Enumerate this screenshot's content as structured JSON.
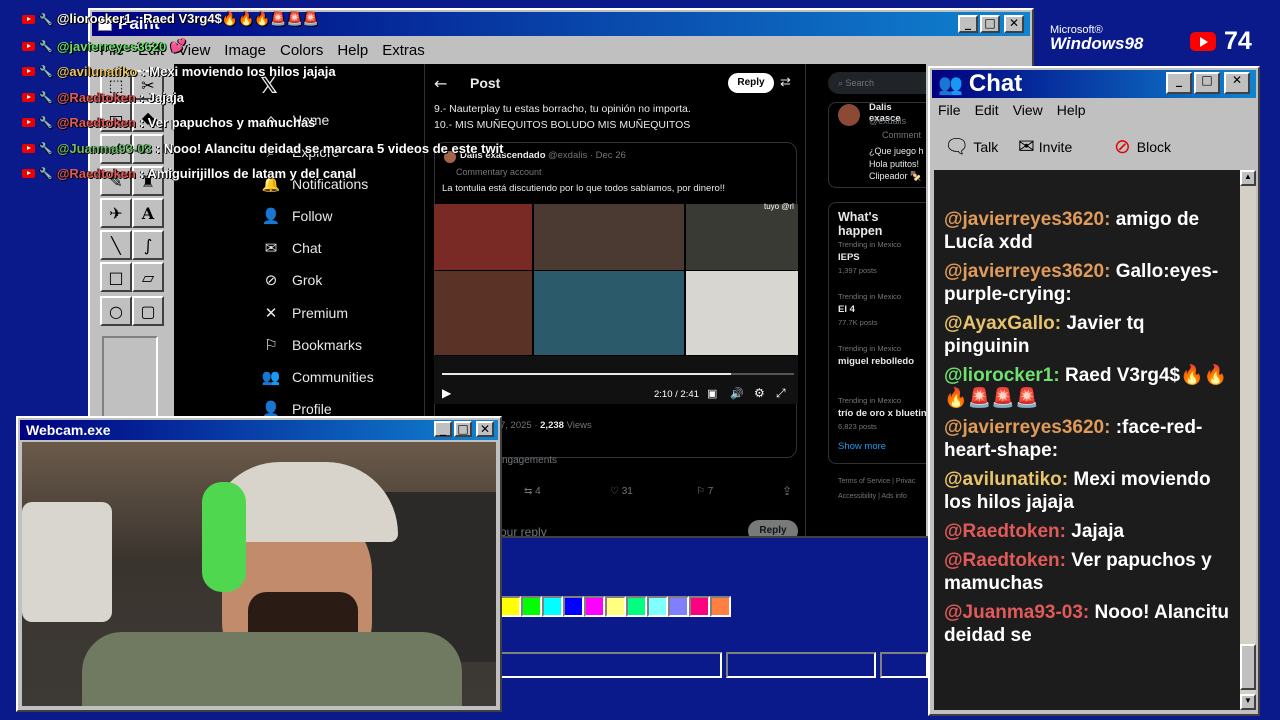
{
  "overlay": {
    "top_line": "@liorocker1 : Raed V3rg4$🔥🔥🔥🚨🚨🚨",
    "lines": [
      {
        "user": "@javierreyes3620",
        "text": "💕",
        "color": "#6fe06f"
      },
      {
        "user": "@avilunatiko",
        "text": ": Mexi moviendo los hilos jajaja",
        "color": "#e8c46a"
      },
      {
        "user": "@Raedtoken",
        "text": ": Jajaja",
        "color": "#e05a5a"
      },
      {
        "user": "@Raedtoken",
        "text": ": Ver papuchos y mamuchas",
        "color": "#e05a5a"
      },
      {
        "user": "@Juanma93-03",
        "text": ": Nooo! Alancitu deidad se marcara 5 videos de este twit",
        "color": "#6fbf6f"
      },
      {
        "user": "@Raedtoken",
        "text": ": Amiguirijillos de latam y del canal",
        "color": "#e05a5a"
      }
    ],
    "windows98_logo_small": "Microsoft®",
    "windows98_logo": "Windows98",
    "viewer_count": "74"
  },
  "paint": {
    "title": "Paint",
    "menu": [
      "File",
      "Edit",
      "View",
      "Image",
      "Colors",
      "Help",
      "Extras"
    ],
    "palette": [
      "#ffff00",
      "#00ff00",
      "#00ffff",
      "#0000ff",
      "#ff00ff",
      "#ffff80",
      "#00ff80",
      "#80ffff",
      "#8080ff",
      "#ff0080",
      "#ff8040"
    ]
  },
  "x": {
    "nav": [
      "Home",
      "Explore",
      "Notifications",
      "Follow",
      "Chat",
      "Grok",
      "Premium",
      "Bookmarks",
      "Communities",
      "Profile"
    ],
    "post_header": "Post",
    "reply_button": "Reply",
    "post_line1": "9.- Nauterplay tu estas borracho, tu opinión no importa.",
    "post_line2": "10.- MIS MUÑEQUITOS BOLUDO MIS MUÑEQUITOS",
    "quote_name": "Dalis exascendado",
    "quote_handle": "@exdalis · Dec 26",
    "quote_badge": "Commentary account",
    "quote_text": "La tontulia está discutiendo por lo que todos sabíamos, por dinero!!",
    "video_time": "2:10 / 2:41",
    "video_progress": 0.82,
    "video_label": "tuyo @rl",
    "date_views": "7, 2025 · ",
    "views_count": "2,238",
    "views_label": "Views",
    "engagements": "ngagements",
    "retweets": "4",
    "likes": "31",
    "bookmarks": "7",
    "reply_placeholder": "our reply",
    "reply_button2": "Reply",
    "search_placeholder": "Search",
    "sidebar_user": "Dalis exasce",
    "sidebar_handle": "@exdalis",
    "sidebar_badge": "Comment",
    "sidebar_text1": "¿Que juego h",
    "sidebar_text2": "Hola putitos!",
    "sidebar_text3": "Clipeador 🍢",
    "whats_happening": "What's happen",
    "trends": [
      {
        "meta": "Trending in Mexico",
        "name": "IEPS",
        "posts": "1,397 posts"
      },
      {
        "meta": "Trending in Mexico",
        "name": "El 4",
        "posts": "77.7K posts"
      },
      {
        "meta": "Trending in Mexico",
        "name": "miguel rebolledo",
        "posts": ""
      },
      {
        "meta": "Trending in Mexico",
        "name": "trío de oro x bluetin",
        "posts": "6,823 posts"
      }
    ],
    "show_more": "Show more",
    "footer1": "Terms of Service  |  Privac",
    "footer2": "Accessibility  |  Ads info"
  },
  "chat": {
    "title": "Chat",
    "menu": [
      "File",
      "Edit",
      "View",
      "Help"
    ],
    "toolbar": [
      "Talk",
      "Invite",
      "Block"
    ],
    "messages": [
      {
        "user": "@javierreyes3620:",
        "text": " amigo de Lucía xdd",
        "color": "#e09a5a"
      },
      {
        "user": "@javierreyes3620:",
        "text": " Gallo:eyes-purple-crying:",
        "color": "#e09a5a"
      },
      {
        "user": "@AyaxGallo:",
        "text": " Javier tq pinguinin",
        "color": "#e8c46a"
      },
      {
        "user": "@liorocker1:",
        "text": " Raed V3rg4$🔥🔥🔥🚨🚨🚨",
        "color": "#6fe06f"
      },
      {
        "user": "@javierreyes3620:",
        "text": " :face-red-heart-shape:",
        "color": "#e09a5a"
      },
      {
        "user": "@avilunatiko:",
        "text": " Mexi moviendo los hilos jajaja",
        "color": "#e8c46a"
      },
      {
        "user": "@Raedtoken:",
        "text": " Jajaja",
        "color": "#e05a5a"
      },
      {
        "user": "@Raedtoken:",
        "text": " Ver papuchos y mamuchas",
        "color": "#e05a5a"
      },
      {
        "user": "@Juanma93-03:",
        "text": " Nooo! Alancitu deidad se",
        "color": "#e05a5a"
      }
    ]
  },
  "webcam": {
    "title": "Webcam.exe"
  }
}
